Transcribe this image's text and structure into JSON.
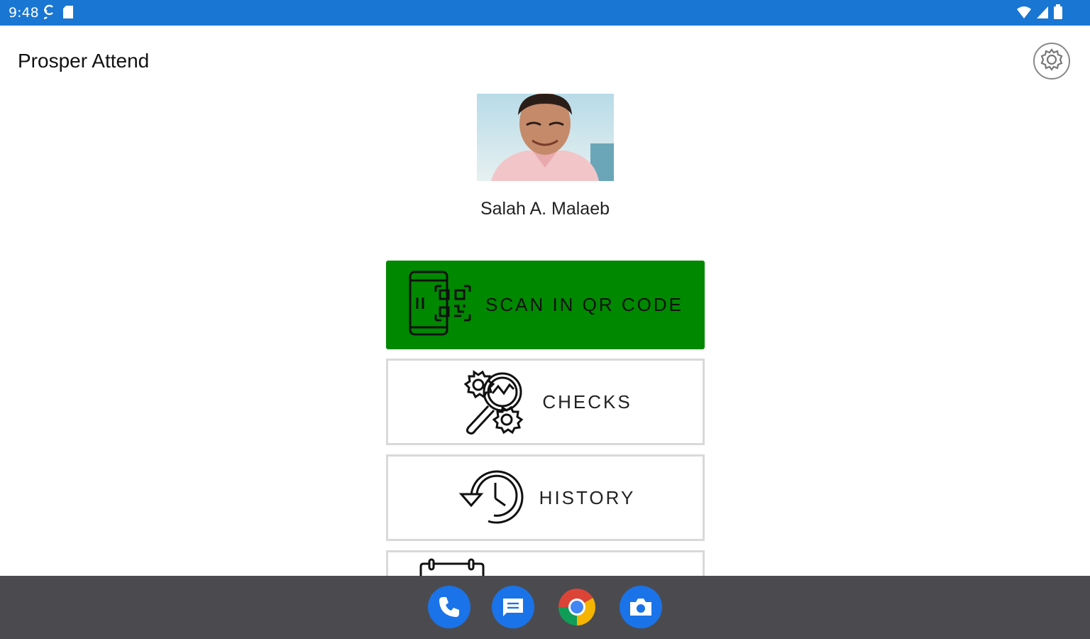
{
  "status_bar": {
    "time": "9:48",
    "left_icons": [
      "sync-icon",
      "sd-card-icon"
    ],
    "right_icons": [
      "wifi-icon",
      "signal-icon",
      "battery-icon"
    ],
    "color": "#1976d2"
  },
  "header": {
    "title": "Prosper Attend",
    "settings_icon": "gear-icon"
  },
  "profile": {
    "name": "Salah A. Malaeb"
  },
  "menu": {
    "scan": {
      "label": "SCAN IN QR CODE",
      "icon": "phone-qr-icon",
      "color": "#008800"
    },
    "checks": {
      "label": "CHECKS",
      "icon": "gear-magnifier-icon"
    },
    "history": {
      "label": "HISTORY",
      "icon": "history-clock-icon"
    },
    "partial": {
      "label": "",
      "icon": "calendar-icon"
    }
  },
  "dock": {
    "apps": [
      "phone-icon",
      "messages-icon",
      "chrome-icon",
      "camera-icon"
    ],
    "color": "#4b4b4f"
  }
}
